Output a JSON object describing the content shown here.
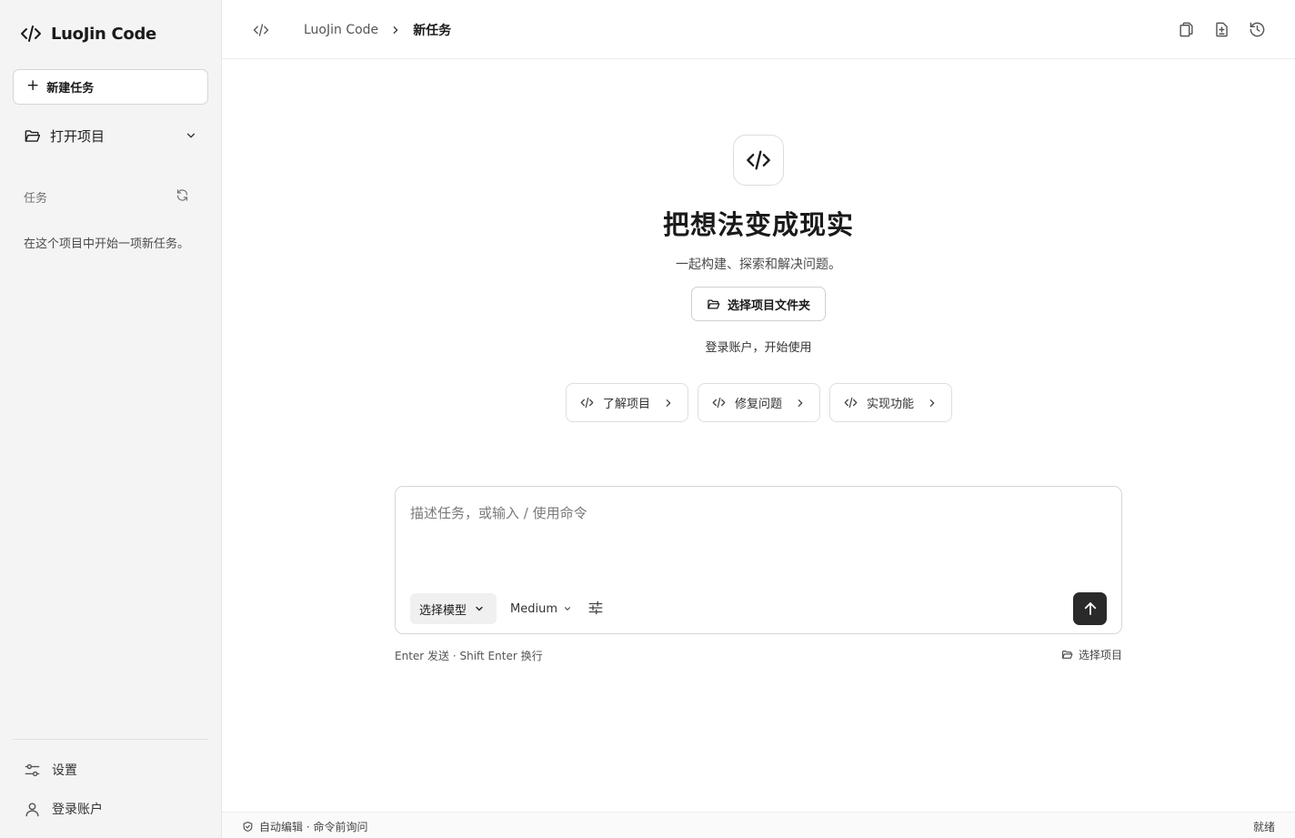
{
  "app": {
    "title": "LuoJin Code"
  },
  "sidebar": {
    "new_task_label": "新建任务",
    "open_project_label": "打开项目",
    "tasks_label": "任务",
    "tasks_empty": "在这个项目中开始一项新任务。",
    "settings_label": "设置",
    "login_label": "登录账户"
  },
  "header": {
    "breadcrumb": [
      "LuoJin Code",
      "新任务"
    ]
  },
  "hero": {
    "title": "把想法变成现实",
    "subtitle": "一起构建、探索和解决问题。",
    "pick_folder_label": "选择项目文件夹",
    "login_hint": "登录账户，开始使用"
  },
  "suggestions": [
    {
      "label": "了解项目"
    },
    {
      "label": "修复问题"
    },
    {
      "label": "实现功能"
    }
  ],
  "composer": {
    "placeholder": "描述任务，或输入 / 使用命令",
    "value": "",
    "model_label": "选择模型",
    "effort_label": "Medium",
    "hint": "Enter 发送 · Shift Enter 换行",
    "project_label": "选择项目"
  },
  "status": {
    "left": "自动编辑 · 命令前询问",
    "right": "就绪"
  },
  "icons": {
    "brand": "code-icon",
    "send": "arrow-up-icon"
  }
}
